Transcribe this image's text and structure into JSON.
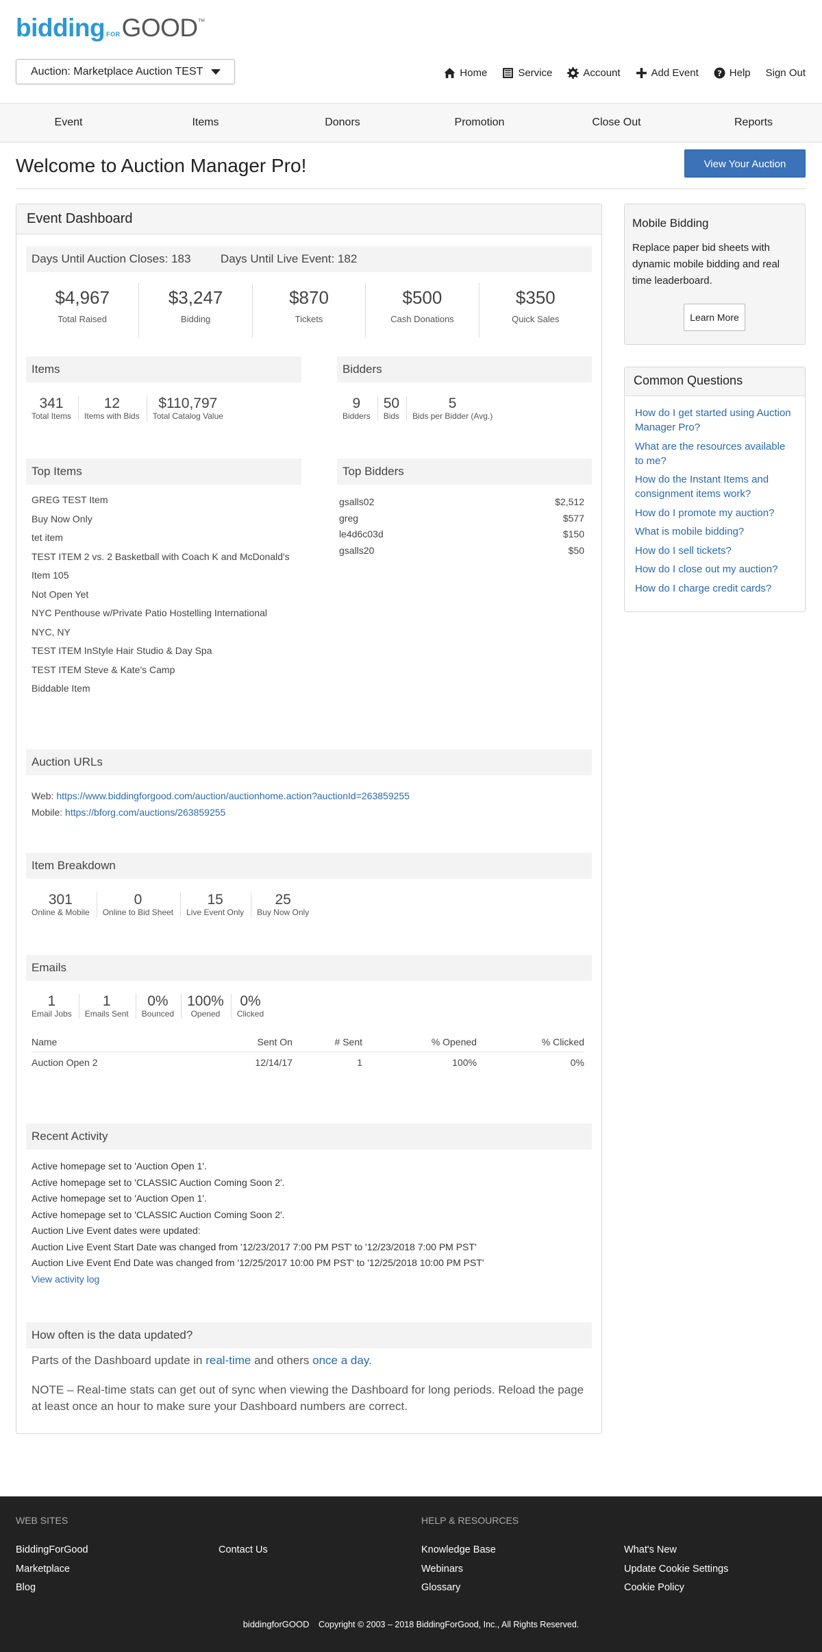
{
  "logo": {
    "part1": "bidding",
    "part2": "FOR",
    "part3": "GOOD",
    "tm": "™"
  },
  "auction_select": {
    "label": "Auction: Marketplace Auction TEST"
  },
  "topnav": {
    "home": "Home",
    "service": "Service",
    "account": "Account",
    "add_event": "Add Event",
    "help": "Help",
    "sign_out": "Sign Out"
  },
  "mainnav": [
    "Event",
    "Items",
    "Donors",
    "Promotion",
    "Close Out",
    "Reports"
  ],
  "welcome": "Welcome to Auction Manager Pro!",
  "view_button": "View Your Auction",
  "dashboard": {
    "title": "Event Dashboard",
    "days_close": "Days Until Auction Closes: 183",
    "days_live": "Days Until Live Event: 182",
    "summary": [
      {
        "value": "$4,967",
        "label": "Total Raised"
      },
      {
        "value": "$3,247",
        "label": "Bidding"
      },
      {
        "value": "$870",
        "label": "Tickets"
      },
      {
        "value": "$500",
        "label": "Cash Donations"
      },
      {
        "value": "$350",
        "label": "Quick Sales"
      }
    ],
    "items": {
      "title": "Items",
      "stats": [
        {
          "value": "341",
          "label": "Total Items"
        },
        {
          "value": "12",
          "label": "Items with Bids"
        },
        {
          "value": "$110,797",
          "label": "Total Catalog Value"
        }
      ]
    },
    "bidders": {
      "title": "Bidders",
      "stats": [
        {
          "value": "9",
          "label": "Bidders"
        },
        {
          "value": "50",
          "label": "Bids"
        },
        {
          "value": "5",
          "label": "Bids per Bidder (Avg.)"
        }
      ]
    },
    "top_items": {
      "title": "Top Items",
      "list": [
        "GREG TEST Item",
        "Buy Now Only",
        "tet item",
        "TEST ITEM 2 vs. 2 Basketball with Coach K and McDonald's",
        "Item 105",
        "Not Open Yet",
        "NYC Penthouse w/Private Patio Hostelling International",
        "NYC, NY",
        "TEST ITEM InStyle Hair Studio & Day Spa",
        "TEST ITEM Steve & Kate's Camp",
        "Biddable Item"
      ]
    },
    "top_bidders": {
      "title": "Top Bidders",
      "list": [
        {
          "name": "gsalls02",
          "amount": "$2,512"
        },
        {
          "name": "greg",
          "amount": "$577"
        },
        {
          "name": "le4d6c03d",
          "amount": "$150"
        },
        {
          "name": "gsalls20",
          "amount": "$50"
        }
      ]
    },
    "urls": {
      "title": "Auction URLs",
      "web_label": "Web:",
      "web": "https://www.biddingforgood.com/auction/auctionhome.action?auctionId=263859255",
      "mobile_label": "Mobile:",
      "mobile": "https://bforg.com/auctions/263859255"
    },
    "breakdown": {
      "title": "Item Breakdown",
      "stats": [
        {
          "value": "301",
          "label": "Online & Mobile"
        },
        {
          "value": "0",
          "label": "Online to Bid Sheet"
        },
        {
          "value": "15",
          "label": "Live Event Only"
        },
        {
          "value": "25",
          "label": "Buy Now Only"
        }
      ]
    },
    "emails": {
      "title": "Emails",
      "stats": [
        {
          "value": "1",
          "label": "Email Jobs"
        },
        {
          "value": "1",
          "label": "Emails Sent"
        },
        {
          "value": "0%",
          "label": "Bounced"
        },
        {
          "value": "100%",
          "label": "Opened"
        },
        {
          "value": "0%",
          "label": "Clicked"
        }
      ],
      "headers": {
        "name": "Name",
        "sent_on": "Sent On",
        "sent": "# Sent",
        "opened": "% Opened",
        "clicked": "% Clicked"
      },
      "rows": [
        {
          "name": "Auction Open 2",
          "sent_on": "12/14/17",
          "sent": "1",
          "opened": "100%",
          "clicked": "0%"
        }
      ]
    },
    "activity": {
      "title": "Recent Activity",
      "list": [
        "Active homepage set to 'Auction Open 1'.",
        "Active homepage set to 'CLASSIC Auction Coming Soon 2'.",
        "Active homepage set to 'Auction Open 1'.",
        "Active homepage set to 'CLASSIC Auction Coming Soon 2'.",
        "Auction Live Event dates were updated:",
        "Auction Live Event Start Date was changed from '12/23/2017 7:00 PM PST' to '12/23/2018 7:00 PM PST'",
        "Auction Live Event End Date was changed from '12/25/2017 10:00 PM PST' to '12/25/2018 10:00 PM PST'"
      ],
      "log_link": "View activity log"
    },
    "frequency": {
      "title": "How often is the data updated?",
      "p1_a": "Parts of the Dashboard update in ",
      "p1_link1": "real-time",
      "p1_b": " and others ",
      "p1_link2": "once a day",
      "p1_c": ".",
      "p2": "NOTE – Real-time stats can get out of sync when viewing the Dashboard for long periods. Reload the page at least once an hour to make sure your Dashboard numbers are correct."
    }
  },
  "mobile_bidding": {
    "title": "Mobile Bidding",
    "desc": "Replace paper bid sheets with dynamic mobile bidding and real time leaderboard.",
    "button": "Learn More"
  },
  "common_questions": {
    "title": "Common Questions",
    "list": [
      "How do I get started using Auction Manager Pro?",
      "What are the resources available to me?",
      "How do the Instant Items and consignment items work?",
      "How do I promote my auction?",
      "What is mobile bidding?",
      "How do I sell tickets?",
      "How do I close out my auction?",
      "How do I charge credit cards?"
    ]
  },
  "footer": {
    "web_sites": "WEB SITES",
    "help": "HELP & RESOURCES",
    "col1": [
      "BiddingForGood",
      "Marketplace",
      "Blog"
    ],
    "col2": [
      "Contact Us"
    ],
    "col3": [
      "Knowledge Base",
      "Webinars",
      "Glossary"
    ],
    "col4": [
      "What's New",
      "Update Cookie Settings",
      "Cookie Policy"
    ],
    "logo": "biddingforGOOD",
    "copyright": "Copyright © 2003 – 2018 BiddingForGood, Inc., All Rights Reserved."
  },
  "colors": {
    "brand_blue": "#2a99d3",
    "button_blue": "#3b72b8",
    "link": "#2a6aab",
    "footer_bg": "#222222"
  }
}
